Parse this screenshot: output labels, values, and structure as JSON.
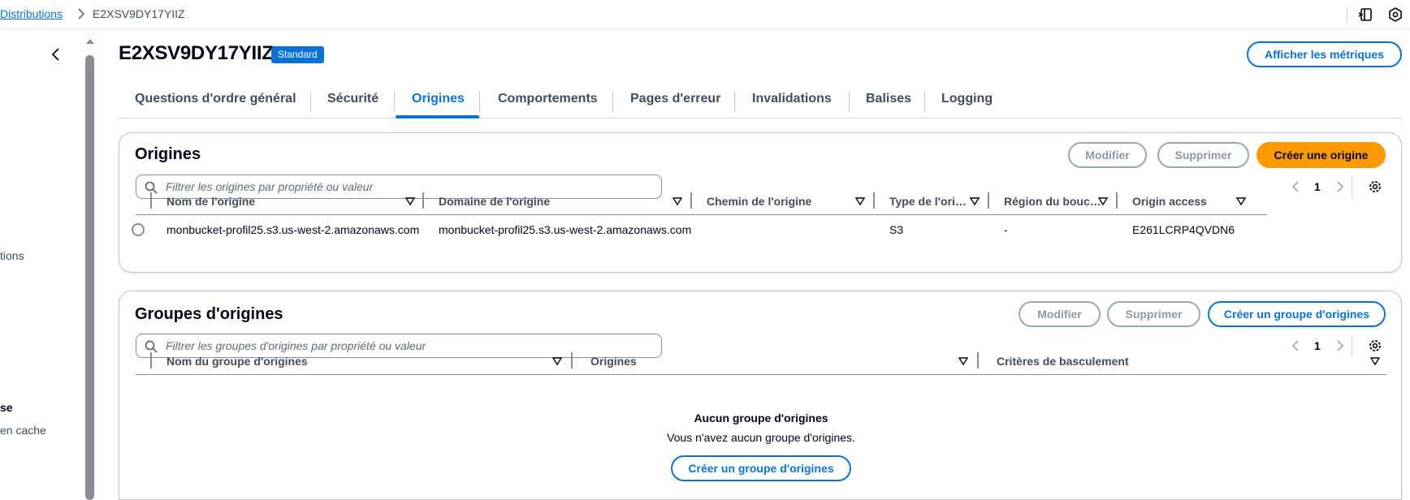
{
  "breadcrumb": {
    "parent": "Distributions",
    "current": "E2XSV9DY17YIIZ"
  },
  "topbar": {
    "icons": [
      "notes-icon",
      "settings-hex-icon"
    ]
  },
  "sidenav": {
    "fragments": [
      "tions",
      "se",
      "en cache"
    ]
  },
  "header": {
    "title": "E2XSV9DY17YIIZ",
    "badge": "Standard",
    "metrics_button": "Afficher les métriques"
  },
  "tabs": [
    {
      "label": "Questions d'ordre général",
      "active": false
    },
    {
      "label": "Sécurité",
      "active": false
    },
    {
      "label": "Origines",
      "active": true
    },
    {
      "label": "Comportements",
      "active": false
    },
    {
      "label": "Pages d'erreur",
      "active": false
    },
    {
      "label": "Invalidations",
      "active": false
    },
    {
      "label": "Balises",
      "active": false
    },
    {
      "label": "Logging",
      "active": false
    }
  ],
  "origins": {
    "title": "Origines",
    "edit_button": "Modifier",
    "delete_button": "Supprimer",
    "create_button": "Créer une origine",
    "filter_placeholder": "Filtrer les origines par propriété ou valeur",
    "page": "1",
    "columns": [
      "Nom de l'origine",
      "Domaine de l'origine",
      "Chemin de l'origine",
      "Type de l'ori…",
      "Région du bouc…",
      "Origin access"
    ],
    "rows": [
      {
        "name": "monbucket-profil25.s3.us-west-2.amazonaws.com",
        "domain": "monbucket-profil25.s3.us-west-2.amazonaws.com",
        "path": "",
        "type": "S3",
        "region": "-",
        "access": "E261LCRP4QVDN6"
      }
    ]
  },
  "origin_groups": {
    "title": "Groupes d'origines",
    "edit_button": "Modifier",
    "delete_button": "Supprimer",
    "create_button": "Créer un groupe d'origines",
    "filter_placeholder": "Filtrer les groupes d'origines par propriété ou valeur",
    "page": "1",
    "columns": [
      "Nom du groupe d'origines",
      "Origines",
      "Critères de basculement"
    ],
    "empty_title": "Aucun groupe d'origines",
    "empty_text": "Vous n'avez aucun groupe d'origines.",
    "empty_button": "Créer un groupe d'origines"
  },
  "colors": {
    "link": "#0972d3",
    "primary": "#ff9900",
    "text": "#000716",
    "muted": "#414d5c"
  }
}
